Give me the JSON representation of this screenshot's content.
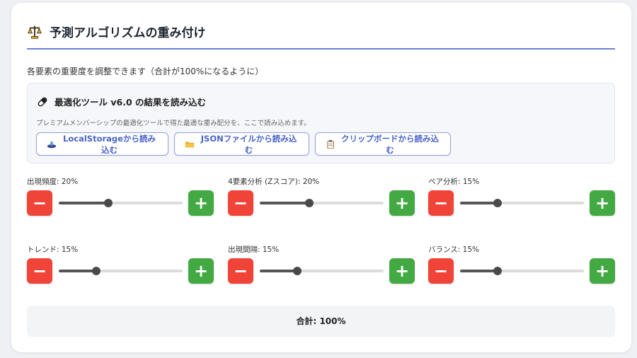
{
  "header": {
    "icon": "balance-scale-icon",
    "title": "予測アルゴリズムの重み付け"
  },
  "description": "各要素の重要度を調整できます（合計が100%になるように）",
  "optimizer": {
    "icon": "pill-capsule-icon",
    "title": "最適化ツール v6.0 の結果を読み込む",
    "subtitle": "プレミアムメンバーシップの最適化ツールで得た最適な重み配分を、ここで読み込めます。",
    "buttons": [
      {
        "icon": "disk-icon",
        "label": "LocalStorageから読み込む"
      },
      {
        "icon": "folder-icon",
        "label": "JSONファイルから読み込む"
      },
      {
        "icon": "clipboard-icon",
        "label": "クリップボードから読み込む"
      }
    ]
  },
  "weights": [
    {
      "label": "出現頻度: 20%",
      "value": 20
    },
    {
      "label": "4要素分析 (Zスコア): 20%",
      "value": 20
    },
    {
      "label": "ペア分析: 15%",
      "value": 15
    },
    {
      "label": "トレンド: 15%",
      "value": 15
    },
    {
      "label": "出現間隔: 15%",
      "value": 15
    },
    {
      "label": "バランス: 15%",
      "value": 15
    }
  ],
  "controls": {
    "minus": "−",
    "plus": "+"
  },
  "slider": {
    "min": 0,
    "max": 50
  },
  "total": "合計: 100%",
  "colors": {
    "accent": "#6b82d6",
    "minus": "#f04438",
    "plus": "#43a943",
    "button_text": "#4a64c8"
  }
}
